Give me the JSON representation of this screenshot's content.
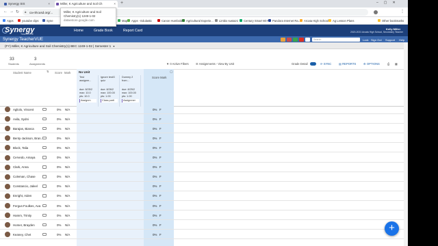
{
  "browser": {
    "tabs": [
      {
        "label": "Synergy SIS",
        "active": false
      },
      {
        "label": "Miller, K Agriculture and Soil Ch",
        "active": true
      },
      {
        "label": "",
        "active": false
      }
    ],
    "url": "ca-nhcusd.org/...",
    "bookmarks": [
      "Apps",
      "youtube clips",
      "Syne",
      "",
      "",
      "",
      "",
      "Map",
      "Apps - Edulastic",
      "Canon Humboldt",
      "Agricultural Experie...",
      "Limbio sustaini",
      "Century Smart Wi-Fi",
      "Pandora Internet Ra...",
      "Arcata High School",
      "Ag Lesson Plans",
      "Other bookmarks"
    ]
  },
  "tooltip": {
    "title": "Miller, K Agriculture and Soil Chemistry(1) 1249-1-02",
    "domain": "dataestore.google.com"
  },
  "header": {
    "logo": "Synergy",
    "logo_sub": "TeacherVUE",
    "menu": [
      "Home",
      "Grade Book",
      "Report Card"
    ],
    "user_name": "Kelly Miller",
    "user_sub": "2020-2021 Arcata High School, Secondary Teacher",
    "subtitle": "Synergy TeacherVUE",
    "search_placeholder": "Search",
    "links": [
      "Lock",
      "Sign Out",
      "Support",
      "Help"
    ]
  },
  "classbar": {
    "selector": "(FY) Miller, K Agriculture and Soil Chemistry(1) BEC 1249-1-02 | Semester 1"
  },
  "stats": {
    "students": "33",
    "students_label": "Students",
    "assignments": "3",
    "assignments_label": "Assignments"
  },
  "toolbar": {
    "filters": "0 Active Filters",
    "view": "Assignments - View By Unit",
    "grade_detail": "Grade Detail",
    "sync": "SYNC",
    "reports": "REPORTS",
    "options": "OPTIONS"
  },
  "columns": {
    "student_name": "Student Name",
    "score": "Score",
    "mark": "Mark",
    "unit": "No Unit",
    "score_mark": "Score Mark"
  },
  "assignments": [
    {
      "name": "Test assignm...",
      "due": "due: 8/25/2",
      "max": "max: 10.0",
      "pts": "pts: 10.0",
      "type": "Assignm"
    },
    {
      "name": "Ignore testG quiz",
      "due": "due: 8/26/2",
      "max": "max: 100.00",
      "pts": "pts: 1.00",
      "type": "Class parti"
    },
    {
      "name": "Dummy 2 from...",
      "due": "due: 8/25/2",
      "max": "max: 100.00",
      "pts": "pts: 1.00",
      "type": "Assignmer"
    }
  ],
  "students": [
    {
      "name": "Agliolo, Vincent",
      "score": "0%",
      "mark": "N/A",
      "total": "0%",
      "grade": "F"
    },
    {
      "name": "Avila, Sydni",
      "score": "0%",
      "mark": "N/A",
      "total": "0%",
      "grade": "F"
    },
    {
      "name": "Barajas, Bianca",
      "score": "0%",
      "mark": "N/A",
      "total": "0%",
      "grade": "F"
    },
    {
      "name": "Benty-Jackson, Bran...",
      "score": "0%",
      "mark": "N/A",
      "total": "0%",
      "grade": "F"
    },
    {
      "name": "Block, Talia",
      "score": "0%",
      "mark": "N/A",
      "total": "0%",
      "grade": "F"
    },
    {
      "name": "Cervedo, Amaya",
      "score": "0%",
      "mark": "N/A",
      "total": "0%",
      "grade": "F"
    },
    {
      "name": "Clark, Anna",
      "score": "0%",
      "mark": "N/A",
      "total": "0%",
      "grade": "F"
    },
    {
      "name": "Coleman, Chase",
      "score": "0%",
      "mark": "N/A",
      "total": "0%",
      "grade": "F"
    },
    {
      "name": "Constancio, Jaleel",
      "score": "0%",
      "mark": "N/A",
      "total": "0%",
      "grade": "F"
    },
    {
      "name": "Enright, Aiden",
      "score": "0%",
      "mark": "N/A",
      "total": "0%",
      "grade": "F"
    },
    {
      "name": "Fergus-Foulkes, Ava",
      "score": "0%",
      "mark": "N/A",
      "total": "0%",
      "grade": "F"
    },
    {
      "name": "Hamm, Trinity",
      "score": "0%",
      "mark": "N/A",
      "total": "0%",
      "grade": "F"
    },
    {
      "name": "Homer, Brayden",
      "score": "0%",
      "mark": "N/A",
      "total": "0%",
      "grade": "F"
    },
    {
      "name": "Keaney, Chet",
      "score": "0%",
      "mark": "N/A",
      "total": "0%",
      "grade": "F"
    }
  ],
  "fab": "+"
}
